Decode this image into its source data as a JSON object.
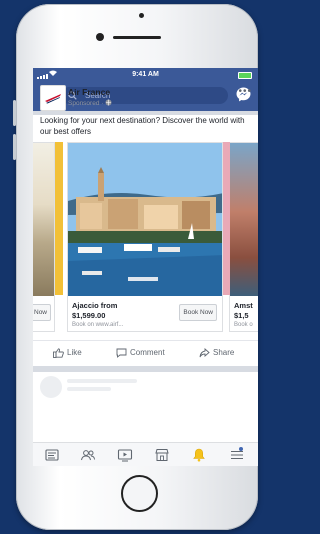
{
  "status_bar": {
    "time": "9:41 AM"
  },
  "search": {
    "placeholder": "Search"
  },
  "post": {
    "advertiser": "Air France",
    "sponsored_label": "Sponsored ·",
    "text": "Looking for your next destination? Discover the world with our best offers"
  },
  "carousel": {
    "cards": [
      {
        "button": "Now"
      },
      {
        "title": "Ajaccio from",
        "price": "$1,599.00",
        "sub": "Book on www.airf...",
        "button": "Book Now"
      },
      {
        "title": "Amst",
        "price": "$1,5",
        "sub": "Book o"
      }
    ]
  },
  "actions": {
    "like": "Like",
    "comment": "Comment",
    "share": "Share"
  },
  "icons": {
    "back": "chevron-left-icon",
    "search": "search-icon",
    "messenger": "messenger-icon",
    "globe": "globe-icon",
    "more": "more-icon",
    "like": "thumbs-up-icon",
    "comment": "comment-icon",
    "share": "share-icon",
    "tabs": [
      "news-feed-icon",
      "friends-icon",
      "watch-icon",
      "marketplace-icon",
      "bell-icon",
      "menu-icon"
    ]
  },
  "colors": {
    "brand": "#3b5998",
    "background": "#14346a",
    "notification": "#f5c21b"
  }
}
